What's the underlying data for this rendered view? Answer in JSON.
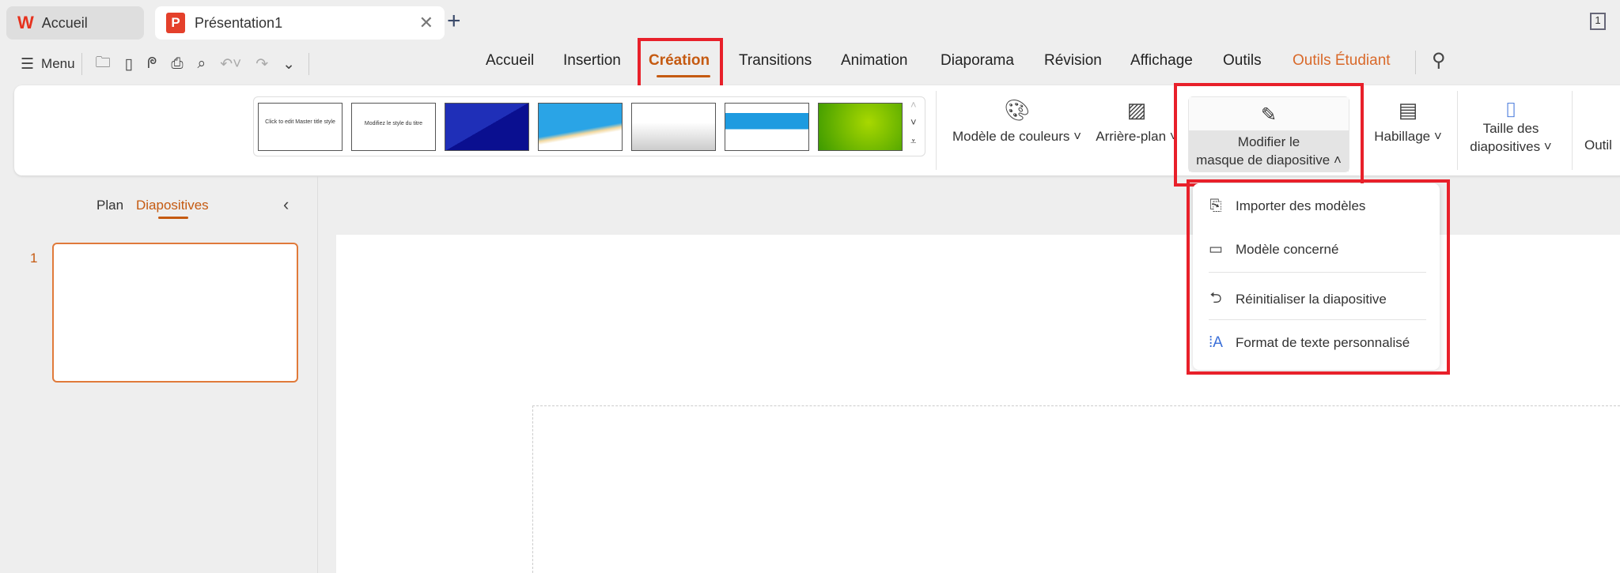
{
  "tabs": [
    {
      "label": "Accueil",
      "icon": "wps-logo-icon"
    },
    {
      "label": "Présentation1",
      "icon": "presentation-icon"
    }
  ],
  "toolbar": {
    "menu_label": "Menu"
  },
  "ribbon_tabs": [
    "Accueil",
    "Insertion",
    "Création",
    "Transitions",
    "Animation",
    "Diaporama",
    "Révision",
    "Affichage",
    "Outils",
    "Outils Étudiant"
  ],
  "active_tab": "Création",
  "gallery_thumbs": [
    "Click to edit Master title style",
    "Modifiez le style du titre"
  ],
  "ribbon_buttons": {
    "color_scheme": "Modèle de couleurs",
    "background": "Arrière-plan",
    "edit_master_1": "Modifier le",
    "edit_master_2": "masque de diapositive",
    "layout": "Habillage",
    "slide_size_1": "Taille des",
    "slide_size_2": "diapositives",
    "tool": "Outil"
  },
  "dropdown": [
    "Importer des modèles",
    "Modèle concerné",
    "Réinitialiser la diapositive",
    "Format de texte personnalisé"
  ],
  "panel": {
    "plan": "Plan",
    "slides": "Diapositives",
    "slide_number": "1"
  },
  "page_indicator": "1",
  "colors": {
    "accent": "#c55a11",
    "highlight": "#e8202a",
    "student": "#d9692a"
  }
}
